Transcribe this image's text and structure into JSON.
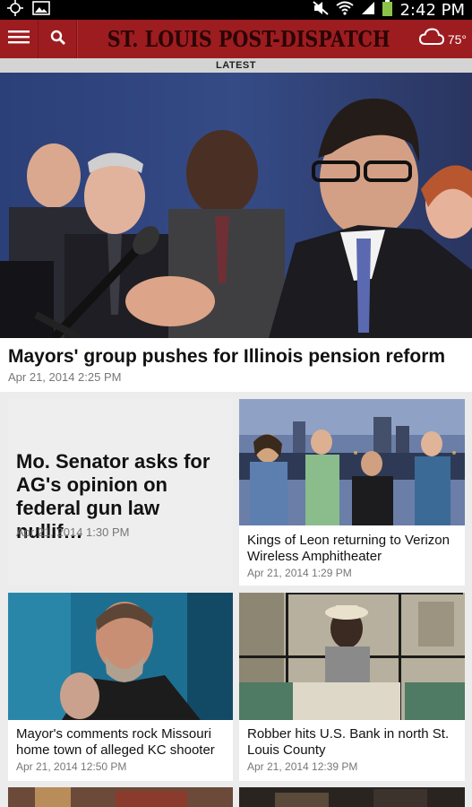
{
  "status_bar": {
    "time": "2:42 PM"
  },
  "app_bar": {
    "masthead": "ST. LOUIS POST-DISPATCH",
    "temperature": "75°"
  },
  "section_label": "LATEST",
  "hero": {
    "title": "Mayors' group pushes for Illinois pension reform",
    "date": "Apr 21, 2014 2:25 PM"
  },
  "cards": [
    {
      "title": "Mo. Senator asks for AG's opinion on federal gun law nullif…",
      "date": "Apr 21, 2014 1:30 PM"
    },
    {
      "title": "Kings of Leon returning to Verizon Wireless Amphitheater",
      "date": "Apr 21, 2014 1:29 PM"
    },
    {
      "title": "Mayor's comments rock Missouri home town of alleged KC shooter",
      "date": "Apr 21, 2014 12:50 PM"
    },
    {
      "title": "Robber hits U.S. Bank in north St. Louis County",
      "date": "Apr 21, 2014 12:39 PM"
    }
  ],
  "colors": {
    "brand_red": "#9d1c20",
    "background": "#ececec"
  }
}
